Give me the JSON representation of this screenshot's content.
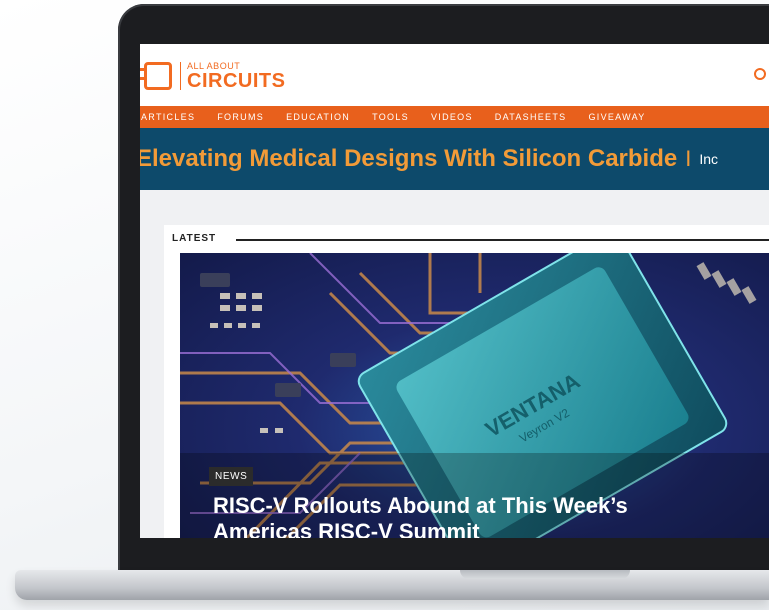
{
  "site": {
    "logo_small": "ALL ABOUT",
    "logo_big": "CIRCUITS",
    "brand_color": "#f26b21"
  },
  "nav": {
    "items": [
      "ARTICLES",
      "FORUMS",
      "EDUCATION",
      "TOOLS",
      "VIDEOS",
      "DATASHEETS",
      "GIVEAWAY"
    ]
  },
  "banner": {
    "title": "Elevating Medical Designs With Silicon Carbide",
    "separator": "I",
    "sub": "Inc",
    "bg_color": "#0d4a6b",
    "accent_color": "#f29b38"
  },
  "main": {
    "section_label": "LATEST",
    "hero": {
      "chip_text_1": "VENTANA",
      "chip_text_2": "Veyron V2",
      "badge": "NEWS",
      "headline_line1": "RISC-V Rollouts Abound at This Week’s",
      "headline_line2": "Americas RISC-V Summit"
    }
  },
  "icons": {
    "search": "search-icon",
    "logo": "chip-logo-icon"
  }
}
